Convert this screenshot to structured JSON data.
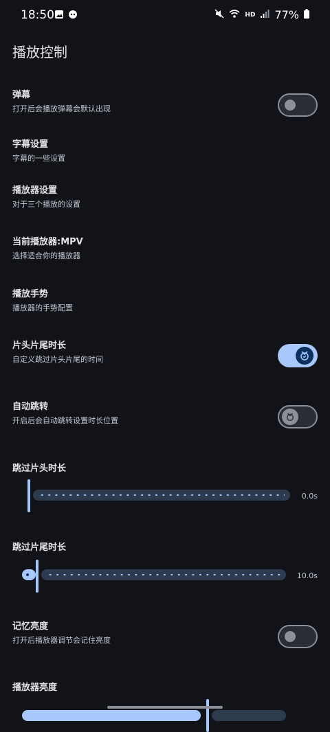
{
  "status_bar": {
    "time": "18:50",
    "battery": "77%",
    "network": "HD",
    "icons": [
      "image-icon",
      "app-icon",
      "mute-icon",
      "wifi-icon",
      "signal-icon",
      "battery-icon"
    ]
  },
  "page_title": "播放控制",
  "settings": [
    {
      "title": "弹幕",
      "subtitle": "打开后会播放弹幕会默认出现",
      "control": "switch",
      "checked": false
    },
    {
      "title": "字幕设置",
      "subtitle": "字幕的一些设置"
    },
    {
      "title": "播放器设置",
      "subtitle": "对于三个播放的设置"
    },
    {
      "title": "当前播放器:MPV",
      "subtitle": "选择适合你的播放器"
    },
    {
      "title": "播放手势",
      "subtitle": "播放器的手势配置"
    },
    {
      "title": "片头片尾时长",
      "subtitle": "自定义跳过片头片尾的时间",
      "control": "switch",
      "checked": true
    },
    {
      "title": "自动跳转",
      "subtitle": "开启后会自动跳转设置时长位置",
      "control": "switch",
      "checked": false,
      "enabled": false
    },
    {
      "title": "记忆亮度",
      "subtitle": "打开后播放器调节会记住亮度",
      "control": "switch",
      "checked": false
    }
  ],
  "sliders": [
    {
      "title": "跳过片头时长",
      "value_label": "0.0s",
      "value": 0.0
    },
    {
      "title": "跳过片尾时长",
      "value_label": "10.0s",
      "value": 10.0
    },
    {
      "title": "播放器亮度",
      "value_label": "",
      "fill_fraction": 0.62
    }
  ],
  "colors": {
    "background": "#111318",
    "accent": "#a8c7fa",
    "track": "#2e3a4d"
  }
}
